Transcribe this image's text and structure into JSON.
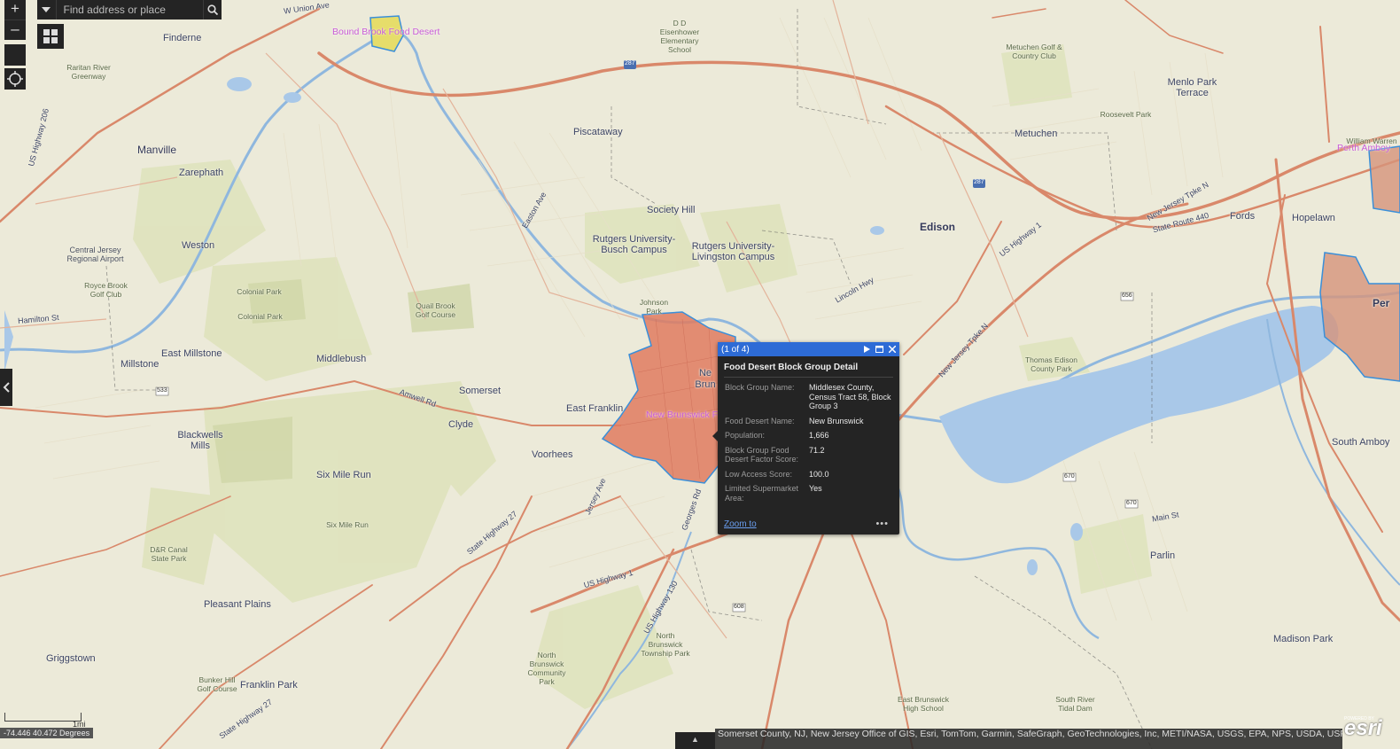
{
  "search": {
    "placeholder": "Find address or place"
  },
  "controls": {
    "zoom_in": "+",
    "zoom_out": "–"
  },
  "layer_labels": {
    "bound_brook": "Bound Brook Food Desert",
    "new_brunswick": "New Brunswick F",
    "perth_amboy": "Perth Amboy",
    "per_partial": "Per"
  },
  "places": {
    "finderne": "Finderne",
    "manville": "Manville",
    "zarephath": "Zarephath",
    "weston": "Weston",
    "east_millstone": "East Millstone",
    "millstone": "Millstone",
    "middlebush": "Middlebush",
    "somerset": "Somerset",
    "east_franklin": "East Franklin",
    "clyde": "Clyde",
    "voorhees": "Voorhees",
    "blackwells_mills": "Blackwells Mills",
    "six_mile_run": "Six Mile Run",
    "pleasant_plains": "Pleasant Plains",
    "griggstown": "Griggstown",
    "franklin_park": "Franklin Park",
    "piscataway": "Piscataway",
    "society_hill": "Society Hill",
    "rutgers_busch": "Rutgers University-Busch Campus",
    "rutgers_livingston": "Rutgers University-Livingston Campus",
    "metuchen": "Metuchen",
    "menlo_park_terrace": "Menlo Park Terrace",
    "edison": "Edison",
    "fords": "Fords",
    "hopelawn": "Hopelawn",
    "south_amboy": "South Amboy",
    "parlin": "Parlin",
    "madison_park": "Madison Park",
    "new_brunswick_partial": "Ne Brun"
  },
  "minor_places": {
    "raritan_river_greenway": "Raritan River Greenway",
    "central_jersey_airport": "Central Jersey Regional Airport",
    "royce_brook": "Royce Brook Golf Club",
    "colonial_park_1": "Colonial Park",
    "colonial_park_2": "Colonial Park",
    "quail_brook": "Quail Brook Golf Course",
    "dr_canal": "D&R Canal State Park",
    "bunker_hill": "Bunker Hill Golf Course",
    "dd_eisenhower": "D D Eisenhower Elementary School",
    "metuchen_golf": "Metuchen Golf & Country Club",
    "roosevelt_park": "Roosevelt Park",
    "johnson_park": "Johnson Park",
    "thomas_edison_park": "Thomas Edison County Park",
    "north_brunswick_park": "North Brunswick Township Park",
    "north_brunswick_community": "North Brunswick Community Park",
    "east_brunswick_hs": "East Brunswick High School",
    "south_river_tidal": "South River Tidal Dam",
    "six_mile_run_small": "Six Mile Run",
    "william_warren": "William Warren"
  },
  "roads": {
    "us_highway_1": "US Highway 1",
    "us_highway_1_b": "US Highway 1",
    "us_highway_206": "US Highway 206",
    "nj_turnpike": "New Jersey Tpke N",
    "nj_turnpike_b": "New Jersey Tpke N",
    "state_route_440": "State Route 440",
    "state_highway_27": "State Highway 27",
    "state_highway_27_b": "State Highway 27",
    "easton_ave": "Easton Ave",
    "amwell_rd": "Amwell Rd",
    "hamilton_st": "Hamilton St",
    "lincoln_hwy": "Lincoln Hwy",
    "jersey_ave": "Jersey Ave",
    "w_union_ave": "W Union Ave",
    "georges_rd": "Georges Rd",
    "us_highway_130": "US Highway 130",
    "main_st": "Main St",
    "i287": "287",
    "i287_b": "287",
    "r656": "656",
    "r670": "670",
    "r670_b": "670",
    "r608": "608",
    "r533": "533"
  },
  "popup": {
    "counter": "(1 of 4)",
    "title": "Food Desert Block Group Detail",
    "fields": [
      {
        "label": "Block Group Name:",
        "value": "Middlesex County, Census Tract 58, Block Group 3"
      },
      {
        "label": "Food Desert Name:",
        "value": "New Brunswick"
      },
      {
        "label": "Population:",
        "value": "1,666"
      },
      {
        "label": "Block Group Food Desert Factor Score:",
        "value": "71.2"
      },
      {
        "label": "Low Access Score:",
        "value": "100.0"
      },
      {
        "label": "Limited Supermarket Area:",
        "value": "Yes"
      }
    ],
    "zoom_to": "Zoom to",
    "more": "•••"
  },
  "scale": {
    "label": "1mi"
  },
  "coordinates": "-74.446 40.472 Degrees",
  "attribution": "Somerset County, NJ, New Jersey Office of GIS, Esri, TomTom, Garmin, SafeGraph, GeoTechnologies, Inc, METI/NASA, USGS, EPA, NPS, USDA, USFWS | N...",
  "attribution_toggle": "▲",
  "logo": {
    "text": "esri",
    "powered": "POWERED BY"
  },
  "colors": {
    "popup_bg": "#242424",
    "popup_header": "#2d6bd6",
    "food_desert_fill": "#e07b5f",
    "food_desert_outline": "#3a8fd9",
    "water": "#a9c8e8",
    "road": "#d9886a",
    "park": "#dde3b8"
  }
}
